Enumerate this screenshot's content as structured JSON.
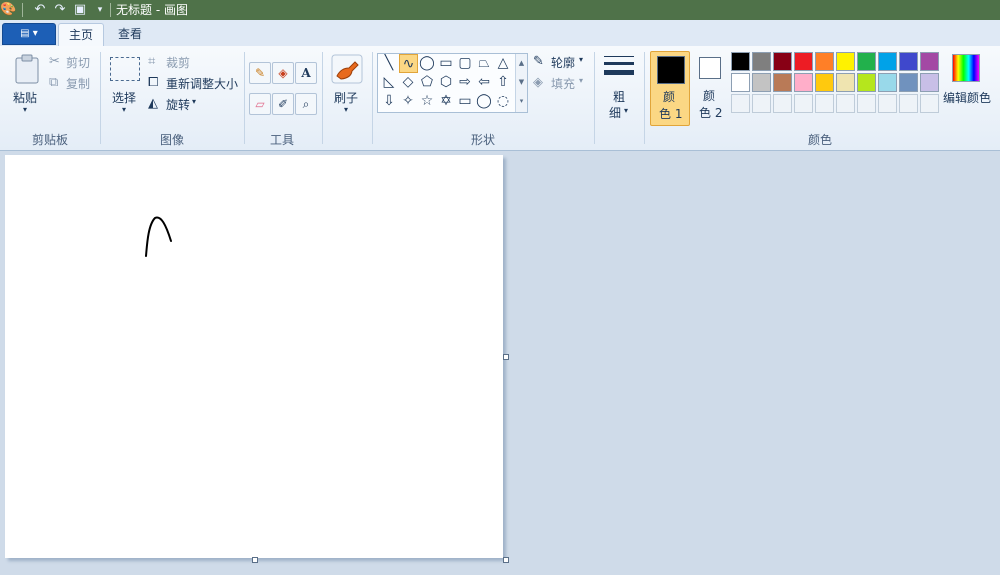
{
  "titlebar": {
    "title": "无标题 - 画图"
  },
  "tabs": [
    {
      "label": "主页"
    },
    {
      "label": "查看"
    }
  ],
  "clipboard": {
    "paste": "粘贴",
    "cut": "剪切",
    "copy": "复制",
    "group": "剪贴板"
  },
  "image": {
    "select": "选择",
    "crop": "裁剪",
    "resize": "重新调整大小",
    "rotate": "旋转",
    "group": "图像"
  },
  "tools": {
    "group": "工具"
  },
  "brushes": {
    "label": "刷子"
  },
  "shapes": {
    "group": "形状",
    "outline": "轮廓",
    "fill": "填充"
  },
  "size": {
    "label1": "粗",
    "label2": "细"
  },
  "colors": {
    "group": "颜色",
    "color1_a": "颜",
    "color1_b": "色 1",
    "color2_a": "颜",
    "color2_b": "色 2",
    "edit": "编辑颜色",
    "row1": [
      "#000000",
      "#7f7f7f",
      "#880015",
      "#ed1c24",
      "#ff7f27",
      "#fff200",
      "#22b14c",
      "#00a2e8",
      "#3f48cc",
      "#a349a4"
    ],
    "row2": [
      "#ffffff",
      "#c3c3c3",
      "#b97a57",
      "#ffaec9",
      "#ffc90e",
      "#efe4b0",
      "#b5e61d",
      "#99d9ea",
      "#7092be",
      "#c8bfe7"
    ]
  }
}
